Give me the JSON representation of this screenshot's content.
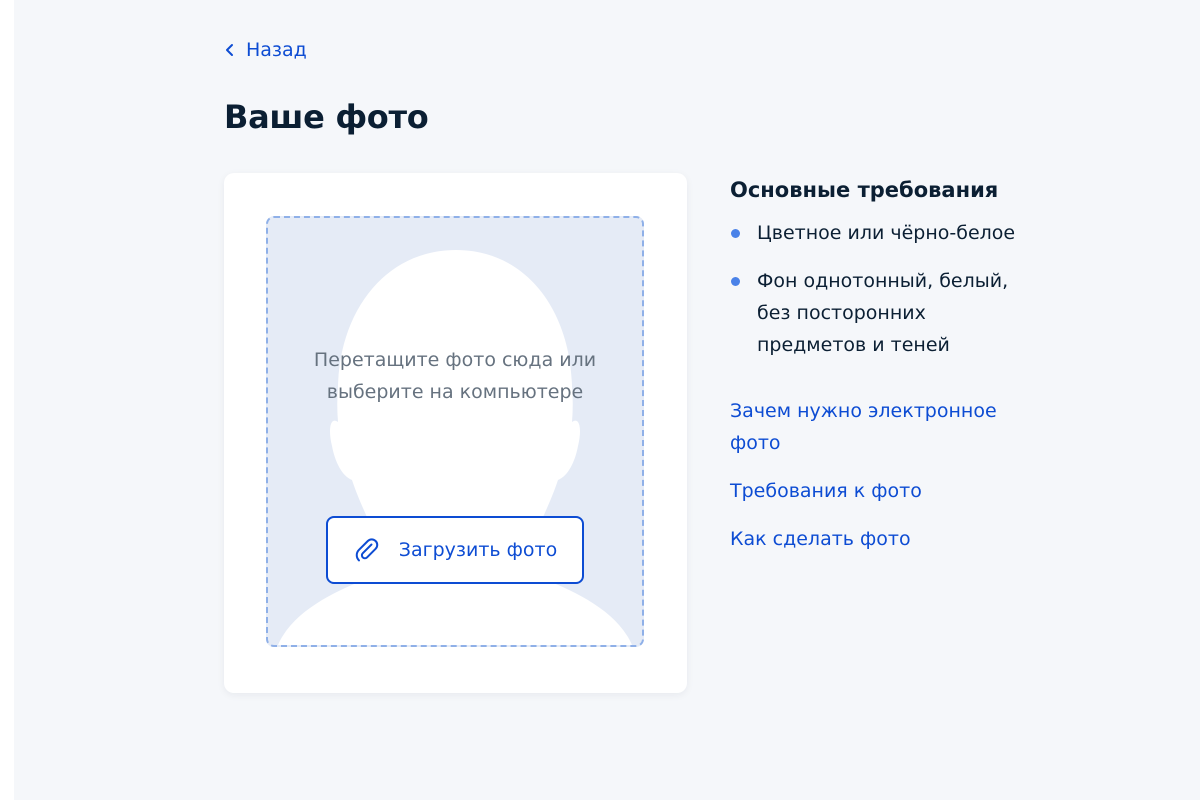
{
  "back": {
    "label": "Назад"
  },
  "page": {
    "title": "Ваше фото"
  },
  "upload": {
    "hint_line1": "Перетащите фото сюда или",
    "hint_line2": "выберите на компьютере",
    "button_label": "Загрузить фото",
    "button_icon": "paperclip-icon"
  },
  "requirements": {
    "title": "Основные требования",
    "items": [
      "Цветное или чёрно-белое",
      "Фон однотонный, белый, без посторонних предметов и теней"
    ]
  },
  "links": [
    "Зачем нужно электронное фото",
    "Требования к фото",
    "Как сделать фото"
  ],
  "colors": {
    "accent": "#0d4cd3",
    "bullet": "#4a82e8",
    "dropzone_bg": "#e5ebf6",
    "dropzone_border": "#8fb0e8",
    "page_bg": "#f5f7fa",
    "text_primary": "#0b1f33",
    "text_hint": "#66727f"
  }
}
